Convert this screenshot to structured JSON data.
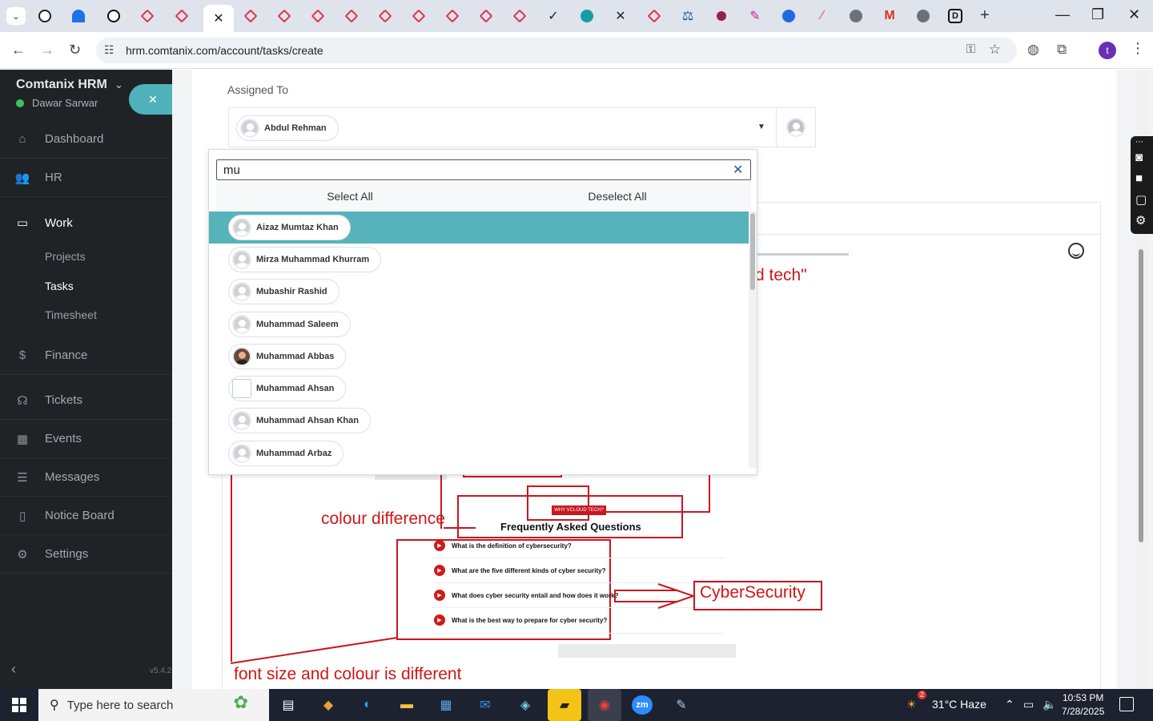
{
  "browser": {
    "url": "hrm.comtanix.com/account/tasks/create",
    "new_tab": "+",
    "active_tab_close": "✕",
    "profile_initial": "t",
    "controls": {
      "minimize": "—",
      "maximize": "❐",
      "close": "✕"
    }
  },
  "sidebar": {
    "brand": "Comtanix HRM",
    "user": "Dawar Sarwar",
    "close_label": "✕",
    "items": [
      {
        "label": "Dashboard",
        "icon": "home-icon"
      },
      {
        "label": "HR",
        "icon": "people-icon"
      },
      {
        "label": "Work",
        "icon": "briefcase-icon"
      },
      {
        "label": "Finance",
        "icon": "dollar-icon"
      },
      {
        "label": "Tickets",
        "icon": "headset-icon"
      },
      {
        "label": "Events",
        "icon": "calendar-icon"
      },
      {
        "label": "Messages",
        "icon": "chat-icon"
      },
      {
        "label": "Notice Board",
        "icon": "clipboard-icon"
      },
      {
        "label": "Settings",
        "icon": "gear-icon"
      }
    ],
    "work_sub": [
      "Projects",
      "Tasks",
      "Timesheet"
    ],
    "version": "v5.4.2"
  },
  "form": {
    "assigned_label": "Assigned To",
    "selected_user": "Abdul Rehman"
  },
  "dropdown": {
    "search_value": "mu",
    "select_all": "Select All",
    "deselect_all": "Deselect All",
    "options": [
      "Aizaz Mumtaz Khan",
      "Mirza Muhammad Khurram",
      "Mubashir Rashid",
      "Muhammad Saleem",
      "Muhammad Abbas",
      "Muhammad Ahsan",
      "Muhammad Ahsan Khan",
      "Muhammad Arbaz"
    ]
  },
  "annotations": {
    "tech_fragment": "d tech\"",
    "colour_difference": "colour difference",
    "faq_title": "Frequently Asked Questions",
    "why_badge": "WHY VCLOUD TECH?",
    "cybersecurity": "CyberSecurity",
    "font_note": "font size and colour is different",
    "faq_questions": [
      "What is the definition of cybersecurity?",
      "What are the five different kinds of cyber security?",
      "What does cyber security entail and how does it work?",
      "What is the best way to prepare for cyber security?"
    ]
  },
  "taskbar": {
    "search_placeholder": "Type here to search",
    "weather": "31°C  Haze",
    "weather_badge": "2",
    "time": "10:53 PM",
    "date": "7/28/2025"
  },
  "colors": {
    "sidebar_bg": "#1f2326",
    "accent_teal": "#56b3bc",
    "annotation_red": "#c8171f"
  }
}
